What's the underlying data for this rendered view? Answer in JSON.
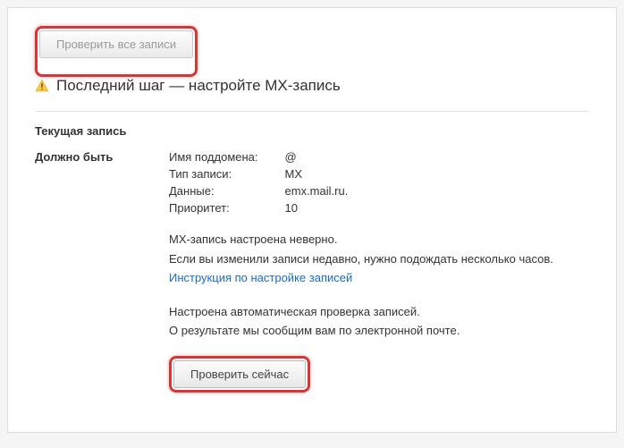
{
  "buttons": {
    "check_all": "Проверить все записи",
    "check_now": "Проверить сейчас"
  },
  "heading": "Последний шаг — настройте MX-запись",
  "current_record_label": "Текущая запись",
  "should_be_label": "Должно быть",
  "fields": {
    "subdomain_label": "Имя поддомена:",
    "subdomain_value": "@",
    "type_label": "Тип записи:",
    "type_value": "MX",
    "data_label": "Данные:",
    "data_value": "emx.mail.ru.",
    "priority_label": "Приоритет:",
    "priority_value": "10"
  },
  "status": {
    "line1": "MX-запись настроена неверно.",
    "line2": "Если вы изменили записи недавно, нужно подождать несколько часов.",
    "link": "Инструкция по настройке записей"
  },
  "auto": {
    "line1": "Настроена автоматическая проверка записей.",
    "line2": "О результате мы сообщим вам по электронной почте."
  }
}
